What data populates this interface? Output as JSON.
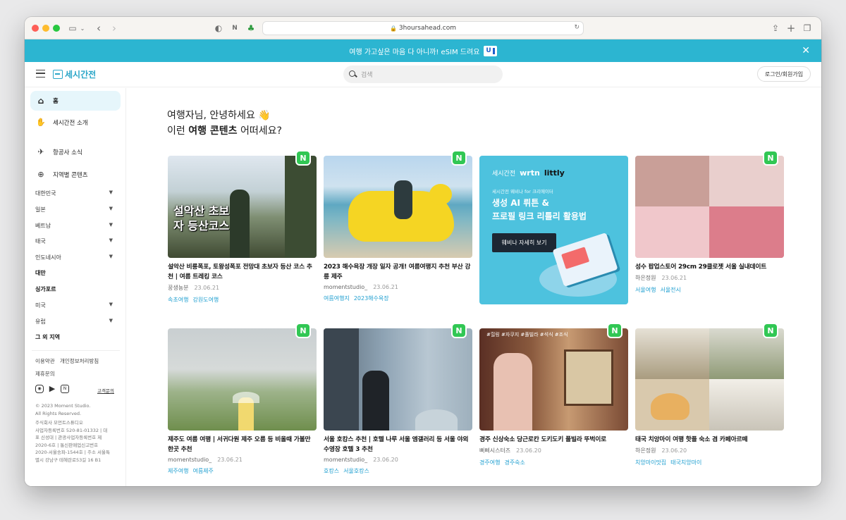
{
  "browser": {
    "url": "3hoursahead.com"
  },
  "banner": {
    "text": "여행 가고싶은 마음 다 아니까! eSIM 드려요",
    "badge": "U"
  },
  "header": {
    "logo_text": "세시간전",
    "search_placeholder": "검색",
    "login_label": "로그인/회원가입"
  },
  "sidebar": {
    "home": "홈",
    "about": "세시간전 소개",
    "airline": "항공사 소식",
    "regional": "지역별 콘텐츠",
    "regions": [
      {
        "label": "대한민국",
        "expand": true
      },
      {
        "label": "일본",
        "expand": true
      },
      {
        "label": "베트남",
        "expand": true
      },
      {
        "label": "태국",
        "expand": true
      },
      {
        "label": "인도네시아",
        "expand": true
      },
      {
        "label": "대만",
        "expand": false
      },
      {
        "label": "싱가포르",
        "expand": false
      },
      {
        "label": "미국",
        "expand": true
      },
      {
        "label": "유럽",
        "expand": true
      },
      {
        "label": "그 외 지역",
        "expand": false
      }
    ],
    "terms": "이용약관",
    "privacy": "개인정보처리방침",
    "partnership": "제휴문의",
    "customer_service": "고객문의",
    "copyright_1": "© 2023 Moment Studio.",
    "copyright_2": "All Rights Reserved.",
    "company_lines": [
      "주식회사 모먼트스튜디오",
      "사업자등록번호 520-81-01332 | 대",
      "표 신성대 | 관광사업자등록번호 제",
      "2020-6호 | 통신판매업신고번호",
      "2020-서울송파-1544호 | 주소 서울특",
      "별시 강남구 테헤란로53길 16 B1"
    ]
  },
  "greeting": {
    "line1": "여행자님, 안녕하세요 👋",
    "line2_pre": "이런 ",
    "line2_bold": "여행 콘텐츠",
    "line2_post": " 어떠세요?"
  },
  "cards": [
    {
      "title": "설악산 비룡폭포, 토왕성폭포 전망대 초보자 등산 코스 추천 | 여름 트레킹 코스",
      "author": "꿍생뇽분",
      "date": "23.06.21",
      "tags": [
        "속초여행",
        "강원도여행"
      ],
      "badge": "N",
      "overlay": "설악산 초보자 등산코스"
    },
    {
      "title": "2023 해수욕장 개장 일자 공개! 여름여행지 추천 부산 강릉 제주",
      "author": "momentstudio_",
      "date": "23.06.21",
      "tags": [
        "여름여행지",
        "2023해수욕장"
      ],
      "badge": "N"
    },
    {
      "title": "성수 팝업스토어 29cm 29클로젯 서울 실내데이트",
      "author": "하은정원",
      "date": "23.06.21",
      "tags": [
        "서울여행",
        "서울전시"
      ],
      "badge": "N"
    },
    {
      "title": "제주도 여름 여행 | 서귀다원 제주 오름 등 비올때 가볼만 한곳 추천",
      "author": "momentstudio_",
      "date": "23.06.21",
      "tags": [
        "제주여행",
        "여름제주"
      ],
      "badge": "N"
    },
    {
      "title": "서울 호캉스 추천 | 호텔 나루 서울 엠갤러리 등 서울 야외수영장 호텔 3 추천",
      "author": "momentstudio_",
      "date": "23.06.20",
      "tags": [
        "호캉스",
        "서울호캉스"
      ],
      "badge": "N"
    },
    {
      "title": "경주 신상숙소 당근로칸 도키도키 풀빌라 뚜벅이로",
      "author": "뻐삐시스터즈",
      "date": "23.06.20",
      "tags": [
        "경주여행",
        "경주숙소"
      ],
      "badge": "N",
      "overlay": "#힐링 #자쿠지 #풀빌라 #석식 #조식"
    },
    {
      "title": "태국 치앙마이 여행 핫플 숙소 겸 카페아르떼",
      "author": "하은정원",
      "date": "23.06.20",
      "tags": [
        "치앙마이맛집",
        "태국치앙마이"
      ],
      "badge": "N"
    }
  ],
  "ad": {
    "brand1": "세시간전",
    "brand2": "wrtn",
    "brand3": "littly",
    "note": "세시간전 웨비나 for 크리에이터",
    "title1": "생성 AI 뤼튼 &",
    "title2": "프로필 링크 리틀리 활용법",
    "button": "웨비나 자세히 보기"
  },
  "colors": {
    "accent": "#2cb5d1",
    "tag": "#1f9fd0",
    "badge": "#31c754"
  }
}
